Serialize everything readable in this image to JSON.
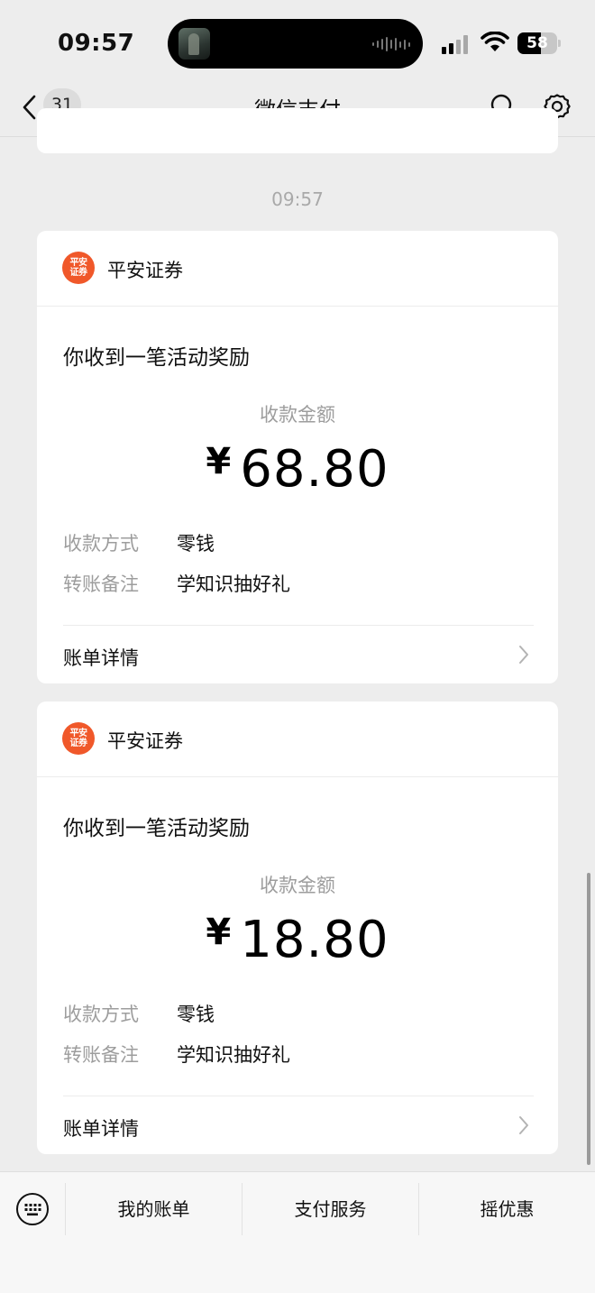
{
  "status_bar": {
    "time": "09:57",
    "battery": "58",
    "battery_level": 0.58
  },
  "nav": {
    "unread_count": "31",
    "title": "微信支付"
  },
  "timestamp": "09:57",
  "messages": [
    {
      "sender": "平安证券",
      "logo_text_line1": "平安",
      "logo_text_line2": "证券",
      "headline": "你收到一笔活动奖励",
      "amount_label": "收款金额",
      "currency": "¥",
      "amount": "68.80",
      "rows": [
        {
          "key": "收款方式",
          "value": "零钱"
        },
        {
          "key": "转账备注",
          "value": "学知识抽好礼"
        }
      ],
      "detail_link": "账单详情"
    },
    {
      "sender": "平安证券",
      "logo_text_line1": "平安",
      "logo_text_line2": "证券",
      "headline": "你收到一笔活动奖励",
      "amount_label": "收款金额",
      "currency": "¥",
      "amount": "18.80",
      "rows": [
        {
          "key": "收款方式",
          "value": "零钱"
        },
        {
          "key": "转账备注",
          "value": "学知识抽好礼"
        }
      ],
      "detail_link": "账单详情"
    }
  ],
  "bottom_menu": {
    "items": [
      "我的账单",
      "支付服务",
      "摇优惠"
    ]
  },
  "colors": {
    "background": "#ededed",
    "logo_orange": "#f0582a",
    "muted_text": "#9d9d9d"
  }
}
